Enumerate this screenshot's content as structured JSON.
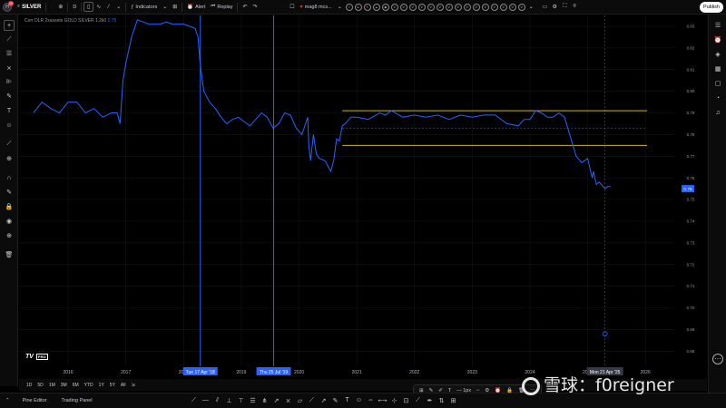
{
  "topbar": {
    "symbol": "SILVER",
    "interval": "D",
    "indicators_label": "Indicators",
    "alert_label": "Alert",
    "replay_label": "Replay",
    "watchlist_label": "mag8 mcs...",
    "publish_label": "Publish",
    "notification_count": "10"
  },
  "legend": {
    "text": "Corr DLR 2xassets GOLD SILVER 1.2k0",
    "value": "0.75"
  },
  "chart_data": {
    "type": "line",
    "series": [
      {
        "color": "#2962ff",
        "x": [
          2015.4,
          2015.55,
          2015.7,
          2015.85,
          2016.0,
          2016.15,
          2016.3,
          2016.45,
          2016.6,
          2016.75,
          2016.85,
          2016.9,
          2016.95,
          2017.0,
          2017.1,
          2017.2,
          2017.3,
          2017.4,
          2017.5,
          2017.6,
          2017.7,
          2017.8,
          2017.9,
          2018.0,
          2018.1,
          2018.2,
          2018.25,
          2018.28,
          2018.3,
          2018.35,
          2018.45,
          2018.55,
          2018.65,
          2018.75,
          2018.85,
          2018.95,
          2019.05,
          2019.15,
          2019.25,
          2019.35,
          2019.45,
          2019.55,
          2019.65,
          2019.75,
          2019.85,
          2019.95,
          2020.05,
          2020.15,
          2020.17,
          2020.2,
          2020.25,
          2020.3,
          2020.35,
          2020.45,
          2020.55,
          2020.6,
          2020.65,
          2020.7,
          2020.75,
          2020.8,
          2020.9,
          2021.0,
          2021.2,
          2021.4,
          2021.5,
          2021.6,
          2021.8,
          2022.0,
          2022.2,
          2022.4,
          2022.6,
          2022.8,
          2023.0,
          2023.2,
          2023.4,
          2023.6,
          2023.8,
          2023.9,
          2024.0,
          2024.1,
          2024.2,
          2024.3,
          2024.4,
          2024.5,
          2024.6,
          2024.7,
          2024.8,
          2024.9,
          2025.0,
          2025.05,
          2025.08,
          2025.1,
          2025.15,
          2025.2,
          2025.3,
          2025.35,
          2025.4
        ],
        "y": [
          0.79,
          0.795,
          0.792,
          0.79,
          0.795,
          0.795,
          0.79,
          0.792,
          0.788,
          0.79,
          0.79,
          0.785,
          0.805,
          0.813,
          0.825,
          0.833,
          0.832,
          0.831,
          0.831,
          0.831,
          0.832,
          0.831,
          0.831,
          0.831,
          0.83,
          0.829,
          0.825,
          0.815,
          0.81,
          0.8,
          0.795,
          0.792,
          0.788,
          0.785,
          0.787,
          0.788,
          0.786,
          0.784,
          0.787,
          0.79,
          0.788,
          0.783,
          0.785,
          0.79,
          0.789,
          0.783,
          0.78,
          0.788,
          0.775,
          0.768,
          0.78,
          0.771,
          0.769,
          0.768,
          0.763,
          0.768,
          0.778,
          0.777,
          0.784,
          0.785,
          0.788,
          0.788,
          0.787,
          0.79,
          0.789,
          0.791,
          0.788,
          0.789,
          0.788,
          0.789,
          0.787,
          0.789,
          0.788,
          0.789,
          0.789,
          0.785,
          0.784,
          0.787,
          0.787,
          0.791,
          0.79,
          0.788,
          0.788,
          0.79,
          0.788,
          0.779,
          0.77,
          0.767,
          0.769,
          0.763,
          0.76,
          0.763,
          0.757,
          0.758,
          0.755,
          0.756,
          0.756
        ]
      }
    ],
    "ylim": [
      0.673,
      0.835
    ],
    "xlim": [
      2015.15,
      2026.5
    ],
    "y_ticks": [
      "0.83",
      "0.82",
      "0.81",
      "0.80",
      "0.79",
      "0.78",
      "0.77",
      "0.76",
      "0.75",
      "0.74",
      "0.73",
      "0.72",
      "0.71",
      "0.70",
      "0.69",
      "0.68"
    ],
    "x_ticks": [
      "2016",
      "2017",
      "2018",
      "2019",
      "2020",
      "2021",
      "2022",
      "2023",
      "2024",
      "2025",
      "2026"
    ],
    "current_value": "0.75",
    "vertical_markers": [
      {
        "label": "Tue 17 Apr '18"
      },
      {
        "label": "Thu 25 Jul '19"
      }
    ],
    "cursor_label": "Mon 21 Apr '25",
    "channel_upper": 0.791,
    "channel_lower": 0.775,
    "channel_mid": 0.783,
    "grid": true
  },
  "ranges": [
    "1D",
    "5D",
    "1M",
    "3M",
    "6M",
    "YTD",
    "1Y",
    "5Y",
    "All"
  ],
  "footer": {
    "pine_editor": "Pine Editor",
    "trading_panel": "Trading Panel"
  },
  "floatbar": {
    "width_label": "1px"
  },
  "watermark": {
    "text": "雪球：f0reigner"
  },
  "tv_logo": {
    "text": "TV",
    "badge": "PRO"
  }
}
